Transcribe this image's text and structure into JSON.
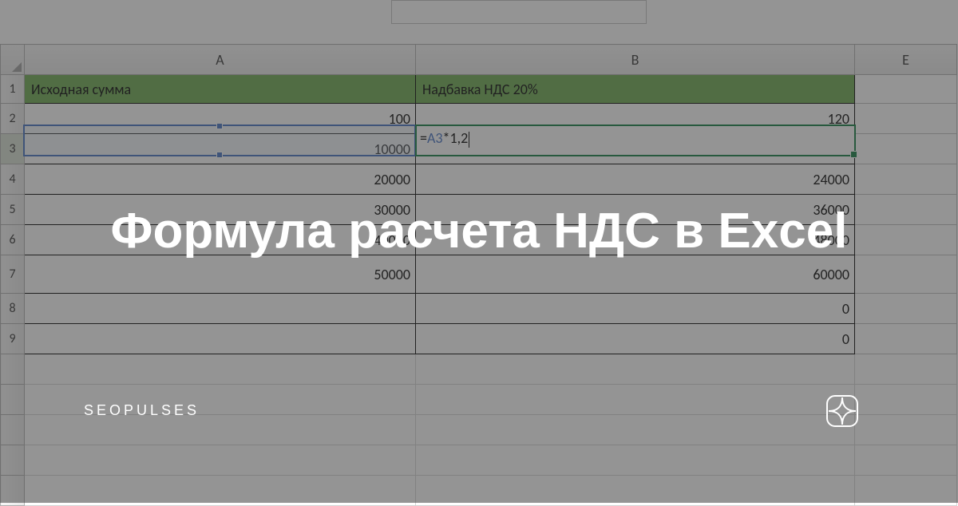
{
  "columns": {
    "A": "A",
    "B": "B",
    "E": "E"
  },
  "row_labels": [
    "1",
    "2",
    "3",
    "4",
    "5",
    "6",
    "7",
    "8",
    "9"
  ],
  "headers": {
    "A": "Исходная сумма",
    "B": "Надбавка НДС 20%"
  },
  "rows": [
    {
      "A": "100",
      "B": "120"
    },
    {
      "A": "10000",
      "B": ""
    },
    {
      "A": "20000",
      "B": "24000"
    },
    {
      "A": "30000",
      "B": "36000"
    },
    {
      "A": "40000",
      "B": "48000"
    },
    {
      "A": "50000",
      "B": "60000"
    },
    {
      "A": "",
      "B": "0"
    },
    {
      "A": "",
      "B": "0"
    }
  ],
  "formula": {
    "eq": "=",
    "ref": "A3",
    "rest": "*1,2"
  },
  "overlay": {
    "title": "Формула расчета НДС в Excel",
    "brand": "SEOPULSES"
  }
}
